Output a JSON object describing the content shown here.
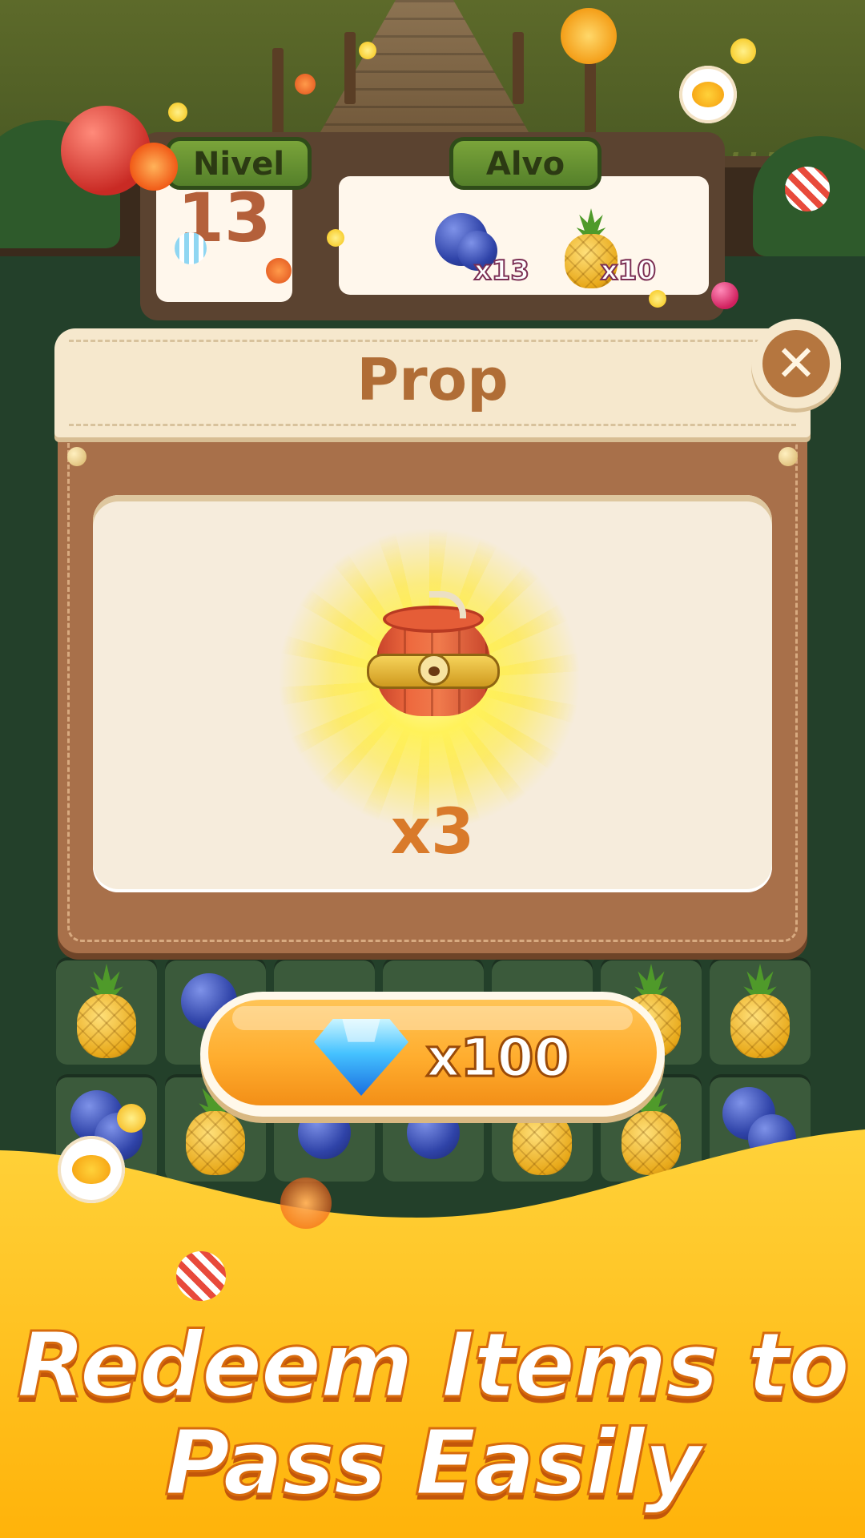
{
  "hud": {
    "level_label": "Nivel",
    "level_value": "13",
    "target_label": "Alvo",
    "goals": [
      {
        "icon": "blueberry-icon",
        "count": "x13"
      },
      {
        "icon": "pineapple-icon",
        "count": "x10"
      }
    ]
  },
  "modal": {
    "title": "Prop",
    "reward": {
      "icon": "barrel-bomb-icon",
      "quantity": "x3"
    },
    "buy_button": {
      "icon": "diamond-icon",
      "price": "x100"
    }
  },
  "banner": {
    "line1": "Redeem Items to",
    "line2": "Pass Easily"
  },
  "colors": {
    "accent_orange": "#ffad2e",
    "title_brown": "#b06d36",
    "banner_yellow": "#ffc21a",
    "board_green": "#23402a"
  }
}
